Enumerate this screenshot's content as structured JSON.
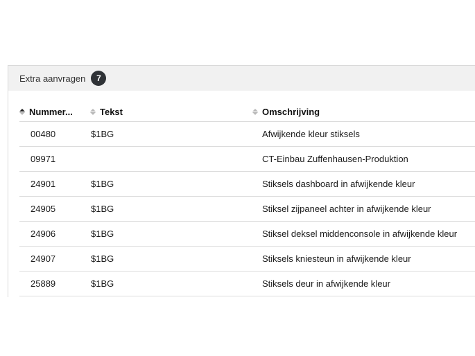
{
  "panel": {
    "title": "Extra aanvragen",
    "count": "7"
  },
  "table": {
    "columns": [
      {
        "label": "Nummer...",
        "sort": "ascending"
      },
      {
        "label": "Tekst",
        "sort": "none"
      },
      {
        "label": "Omschrijving",
        "sort": "none"
      }
    ],
    "rows": [
      {
        "nummer": "00480",
        "tekst": "$1BG",
        "omschrijving": "Afwijkende kleur stiksels"
      },
      {
        "nummer": "09971",
        "tekst": "",
        "omschrijving": "CT-Einbau Zuffenhausen-Produktion"
      },
      {
        "nummer": "24901",
        "tekst": "$1BG",
        "omschrijving": "Stiksels dashboard in afwijkende kleur"
      },
      {
        "nummer": "24905",
        "tekst": "$1BG",
        "omschrijving": "Stiksel zijpaneel achter in afwijkende kleur"
      },
      {
        "nummer": "24906",
        "tekst": "$1BG",
        "omschrijving": "Stiksel deksel middenconsole in afwijkende kleur"
      },
      {
        "nummer": "24907",
        "tekst": "$1BG",
        "omschrijving": "Stiksels kniesteun in afwijkende kleur"
      },
      {
        "nummer": "25889",
        "tekst": "$1BG",
        "omschrijving": "Stiksels deur in afwijkende kleur"
      }
    ]
  }
}
